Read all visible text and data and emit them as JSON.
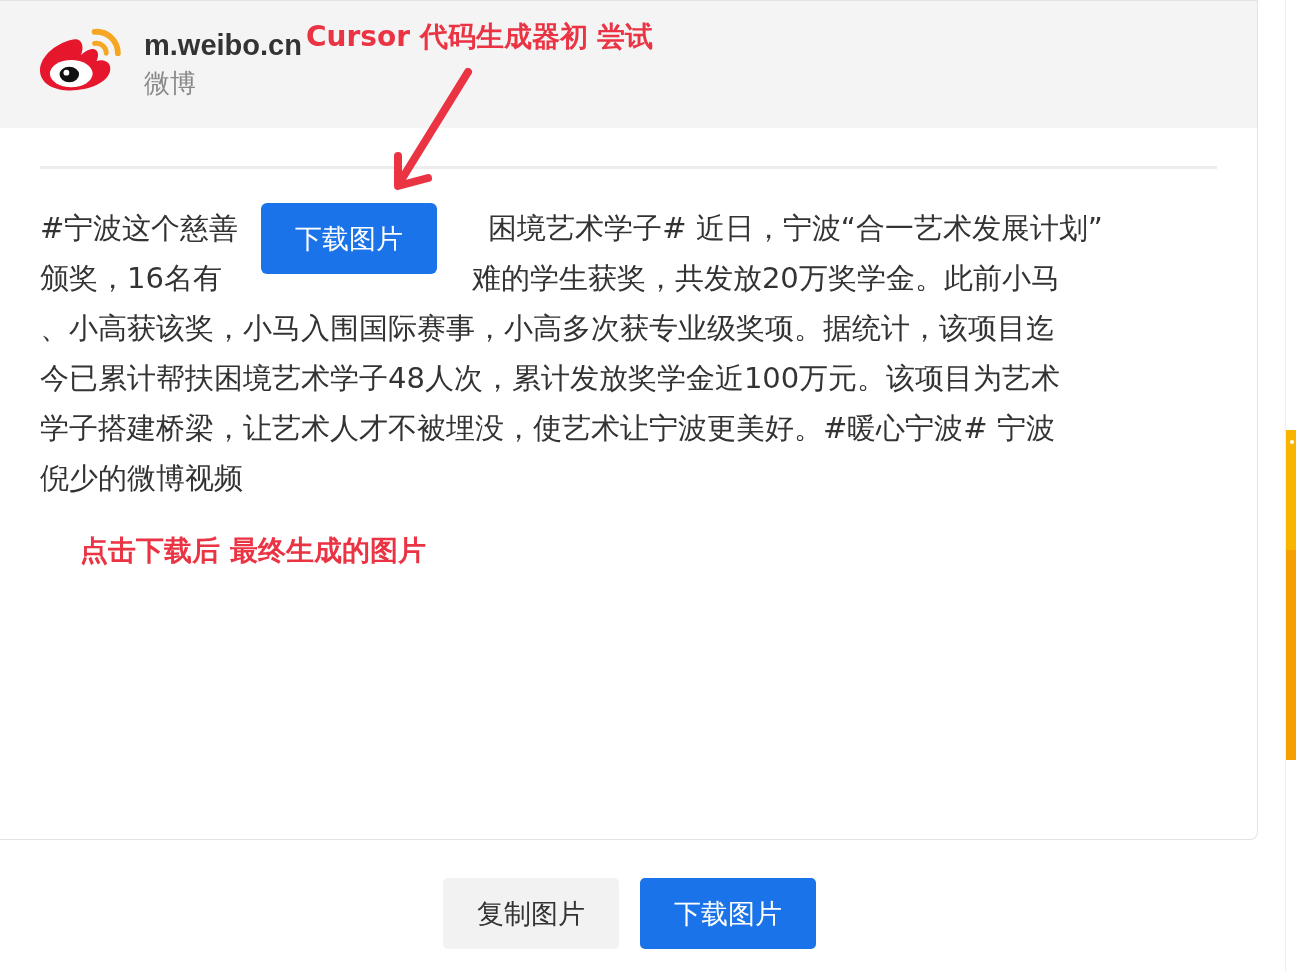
{
  "header": {
    "site": "m.weibo.cn",
    "name": "微博"
  },
  "post_lines": [
    [
      {
        "kind": "text",
        "text": "#宁波这个慈善"
      },
      {
        "kind": "gap"
      },
      {
        "kind": "text",
        "text": "困境艺术学子# 近日，宁波“合一艺术发展计划”"
      }
    ],
    [
      {
        "kind": "text",
        "text": "颁奖，16名有"
      },
      {
        "kind": "gap"
      },
      {
        "kind": "text",
        "text": "难的学生获奖，共发放20万奖学金。此前小马"
      }
    ],
    [
      {
        "kind": "text",
        "text": "、小高获该奖，小马入围国际赛事，小高多次获专业级奖项。据统计，该项目迄"
      }
    ],
    [
      {
        "kind": "text",
        "text": "今已累计帮扶困境艺术学子48人次，累计发放奖学金近100万元。该项目为艺术"
      }
    ],
    [
      {
        "kind": "text",
        "text": "学子搭建桥梁，让艺术人才不被埋没，使艺术让宁波更美好。#暖心宁波# 宁波"
      }
    ],
    [
      {
        "kind": "text",
        "text": "倪少的微博视频"
      }
    ]
  ],
  "floating_button": "下载图片",
  "annotations": [
    "Cursor 代码生成器初 尝试",
    "点击下载后 最终生成的图片"
  ],
  "buttons": [
    {
      "label": "复制图片",
      "kind": "secondary"
    },
    {
      "label": "下载图片",
      "kind": "primary"
    }
  ]
}
